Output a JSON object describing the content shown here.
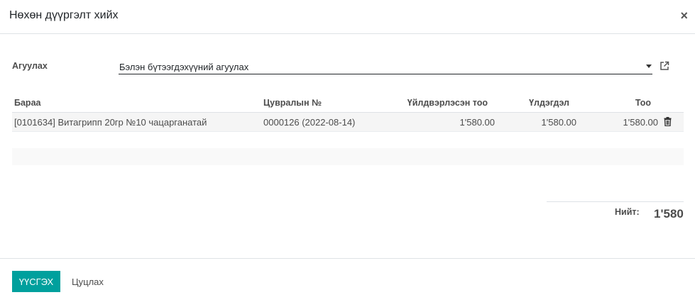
{
  "dialog": {
    "title": "Нөхөн дүүргэлт хийх",
    "close_symbol": "×"
  },
  "warehouse_field": {
    "label": "Агуулах",
    "value": "Бэлэн бүтээгдэхүүний агуулах",
    "dropdown_icon": "caret-down-icon",
    "open_icon": "external-link-icon"
  },
  "table": {
    "headers": {
      "product": "Бараа",
      "serial": "Цувралын №",
      "produced_qty": "Үйлдвэрлэсэн тоо",
      "remaining": "Үлдэгдэл",
      "qty": "Тоо"
    },
    "rows": [
      {
        "product": "[0101634] Витагрипп 20гр №10 чацарганатай",
        "serial": "0000126 (2022-08-14)",
        "produced_qty": "1'580.00",
        "remaining": "1'580.00",
        "qty": "1'580.00"
      }
    ],
    "row_delete_icon": "trash-icon"
  },
  "total": {
    "label": "Нийт:",
    "value": "1'580"
  },
  "footer": {
    "confirm_label": "ҮҮСГЭХ",
    "cancel_label": "Цуцлах"
  },
  "colors": {
    "primary": "#00a09d"
  }
}
